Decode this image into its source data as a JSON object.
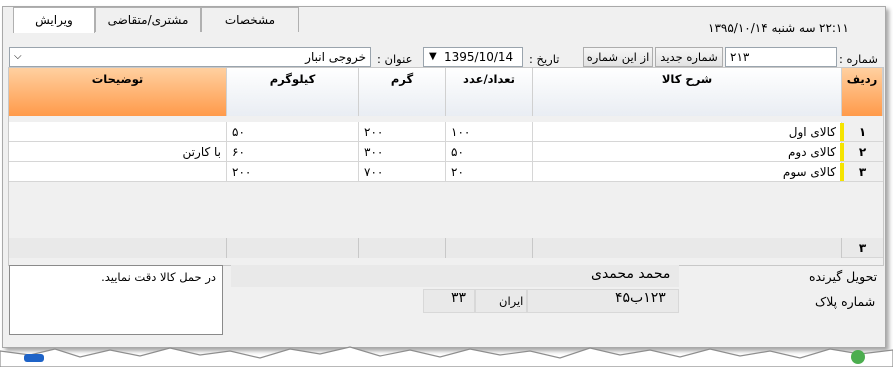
{
  "status": {
    "time": "۲۲:۱۱",
    "date": "سه شنبه ۱۳۹۵/۱۰/۱۴"
  },
  "tabs": [
    {
      "label": "مشخصات"
    },
    {
      "label": "مشتری/متقاضی"
    },
    {
      "label": "ویرایش"
    }
  ],
  "form": {
    "number_label": "شماره :",
    "number_value": "۲۱۳",
    "new_number_btn": "شماره جدید",
    "from_number_btn": "از این شماره",
    "date_label": "تاریخ :",
    "date_value": "1395/10/14",
    "title_label": "عنوان :",
    "title_value": "خروجی انبار"
  },
  "grid": {
    "columns": [
      "ردیف",
      "شرح کالا",
      "تعداد/عدد",
      "گرم",
      "کیلوگرم",
      "توضیحات"
    ],
    "rows": [
      {
        "idx": "۱",
        "desc": "کالای اول",
        "count": "۱۰۰",
        "gram": "۲۰۰",
        "kg": "۵۰",
        "note": ""
      },
      {
        "idx": "۲",
        "desc": "کالای دوم",
        "count": "۵۰",
        "gram": "۳۰۰",
        "kg": "۶۰",
        "note": "با کارتن"
      },
      {
        "idx": "۳",
        "desc": "کالای سوم",
        "count": "۲۰",
        "gram": "۷۰۰",
        "kg": "۲۰۰",
        "note": ""
      }
    ],
    "footer_count": "۳"
  },
  "bottom": {
    "receiver_label": "تحویل گیرنده",
    "receiver_value": "محمد محمدی",
    "plate_label": "شماره پلاک",
    "plate_value": "۱۲۳ب۴۵",
    "plate_country": "ایران",
    "plate_code": "۳۳",
    "note_text": "در حمل کالا دقت نمایید."
  },
  "colors": {
    "header_orange": "#ff9a4a",
    "row_marker": "#f5e400"
  }
}
